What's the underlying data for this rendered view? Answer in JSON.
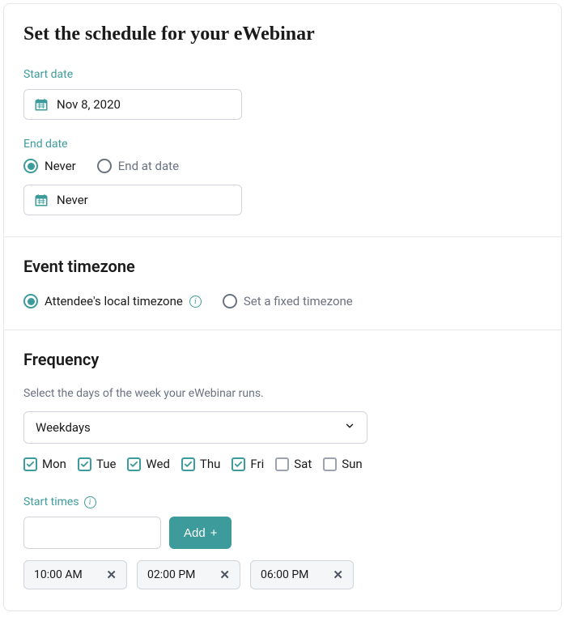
{
  "header": {
    "title": "Set the schedule for your eWebinar"
  },
  "start_date": {
    "label": "Start date",
    "value": "Nov 8, 2020"
  },
  "end_date": {
    "label": "End date",
    "options": {
      "never": "Never",
      "end_at": "End at date"
    },
    "value": "Never"
  },
  "timezone": {
    "heading": "Event timezone",
    "options": {
      "attendee": "Attendee's local timezone",
      "fixed": "Set a fixed timezone"
    }
  },
  "frequency": {
    "heading": "Frequency",
    "hint": "Select the days of the week your eWebinar runs.",
    "preset": "Weekdays",
    "days": [
      {
        "label": "Mon",
        "checked": true
      },
      {
        "label": "Tue",
        "checked": true
      },
      {
        "label": "Wed",
        "checked": true
      },
      {
        "label": "Thu",
        "checked": true
      },
      {
        "label": "Fri",
        "checked": true
      },
      {
        "label": "Sat",
        "checked": false
      },
      {
        "label": "Sun",
        "checked": false
      }
    ]
  },
  "start_times": {
    "label": "Start times",
    "add_label": "Add",
    "chips": [
      "10:00 AM",
      "02:00 PM",
      "06:00 PM"
    ]
  },
  "colors": {
    "accent": "#3e9b9b"
  }
}
